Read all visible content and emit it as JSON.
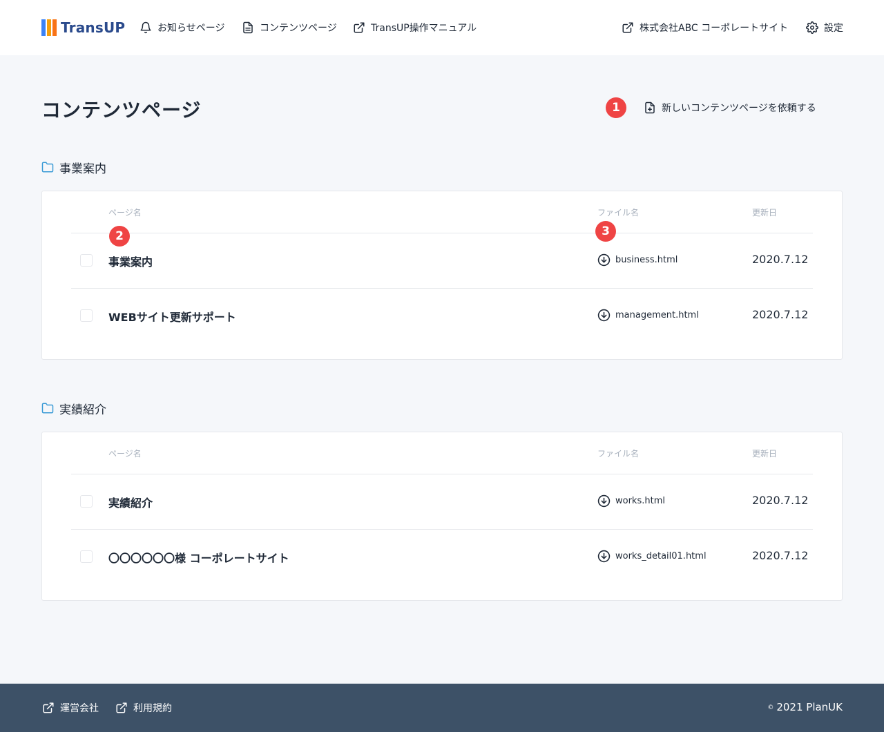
{
  "header": {
    "logo_text": "TransUP",
    "logo_colors": [
      "#3b82f6",
      "#f59e0b",
      "#f97316"
    ],
    "nav": {
      "news": "お知らせページ",
      "contents": "コンテンツページ",
      "manual": "TransUP操作マニュアル",
      "corporate": "株式会社ABC コーポレートサイト",
      "settings": "設定"
    }
  },
  "page": {
    "title": "コンテンツページ",
    "request_button": "新しいコンテンツページを依頼する"
  },
  "badges": [
    "1",
    "2",
    "3"
  ],
  "table_headers": {
    "page_name": "ページ名",
    "file_name": "ファイル名",
    "updated": "更新日"
  },
  "sections": [
    {
      "title": "事業案内",
      "rows": [
        {
          "name": "事業案内",
          "file": "business.html",
          "date": "2020.7.12"
        },
        {
          "name": "WEBサイト更新サポート",
          "file": "management.html",
          "date": "2020.7.12"
        }
      ]
    },
    {
      "title": "実績紹介",
      "rows": [
        {
          "name": "実績紹介",
          "file": "works.html",
          "date": "2020.7.12"
        },
        {
          "name": "〇〇〇〇〇〇様 コーポレートサイト",
          "file": "works_detail01.html",
          "date": "2020.7.12"
        }
      ]
    }
  ],
  "footer": {
    "company": "運営会社",
    "terms": "利用規約",
    "copyright_mark": "©",
    "copyright": "2021 PlanUK"
  },
  "colors": {
    "accent_blue": "#3b9bd6",
    "badge_red": "#ef4444",
    "footer_bg": "#3d5167"
  }
}
